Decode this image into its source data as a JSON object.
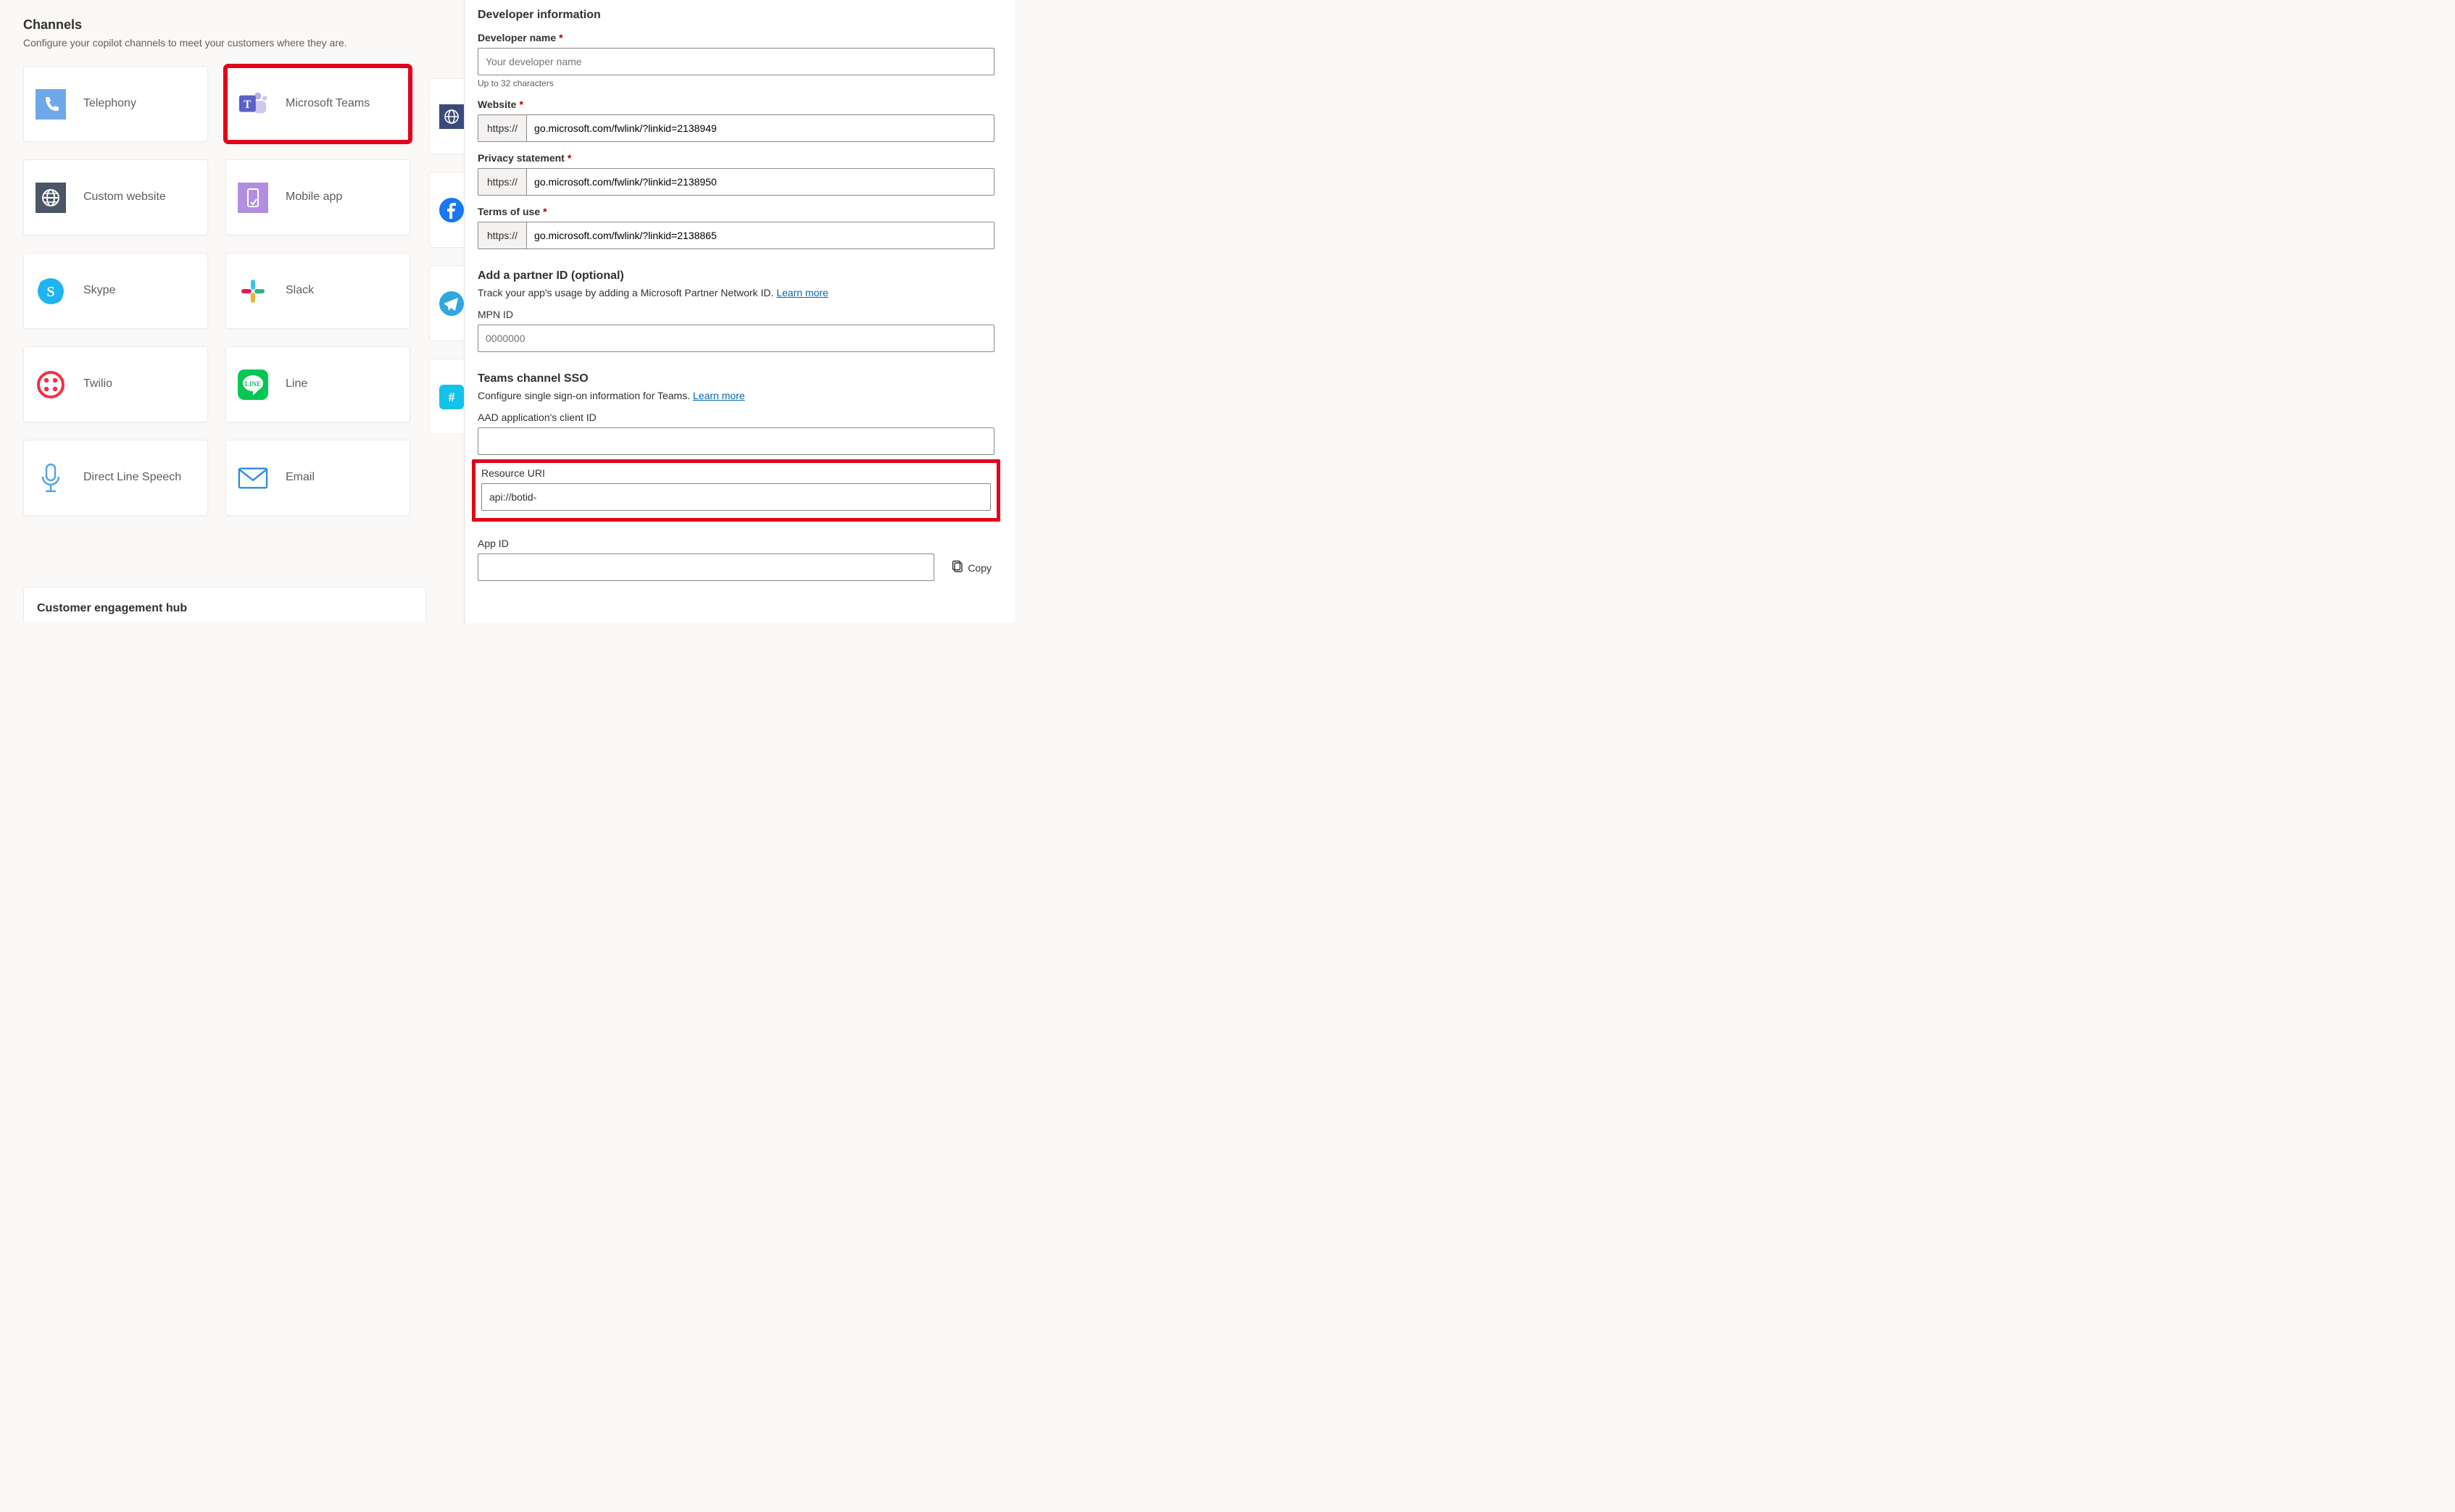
{
  "left": {
    "title": "Channels",
    "subtitle": "Configure your copilot channels to meet your customers where they are.",
    "cards": [
      {
        "label": "Telephony"
      },
      {
        "label": "Microsoft Teams",
        "highlight": true
      },
      {
        "label": "Custom website"
      },
      {
        "label": "Mobile app"
      },
      {
        "label": "Skype"
      },
      {
        "label": "Slack"
      },
      {
        "label": "Twilio"
      },
      {
        "label": "Line"
      },
      {
        "label": "Direct Line Speech"
      },
      {
        "label": "Email"
      }
    ],
    "engagement_hub": "Customer engagement hub"
  },
  "right": {
    "section": "Developer information",
    "dev_name": {
      "label": "Developer name",
      "placeholder": "Your developer name",
      "hint": "Up to 32 characters"
    },
    "website": {
      "label": "Website",
      "prefix": "https://",
      "value": "go.microsoft.com/fwlink/?linkid=2138949"
    },
    "privacy": {
      "label": "Privacy statement",
      "prefix": "https://",
      "value": "go.microsoft.com/fwlink/?linkid=2138950"
    },
    "terms": {
      "label": "Terms of use",
      "prefix": "https://",
      "value": "go.microsoft.com/fwlink/?linkid=2138865"
    },
    "partner": {
      "heading": "Add a partner ID (optional)",
      "desc_prefix": "Track your app's usage by adding a Microsoft Partner Network ID. ",
      "link": "Learn more",
      "mpn_label": "MPN ID",
      "mpn_placeholder": "0000000"
    },
    "sso": {
      "heading": "Teams channel SSO",
      "desc_prefix": "Configure single sign-on information for Teams. ",
      "link": "Learn more",
      "client_id_label": "AAD application's client ID",
      "client_id_value": "",
      "resource_label": "Resource URI",
      "resource_value": "api://botid-",
      "appid_label": "App ID",
      "appid_value": "",
      "copy_label": "Copy"
    }
  }
}
